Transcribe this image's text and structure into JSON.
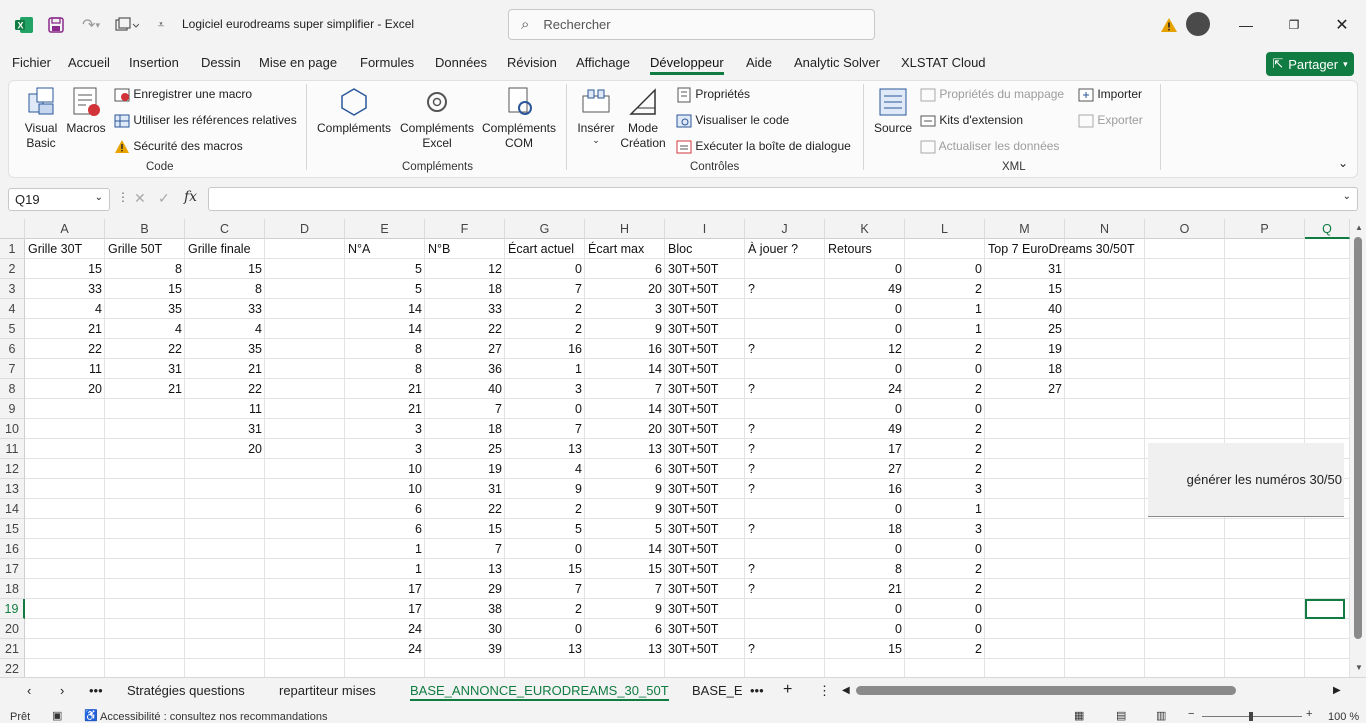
{
  "window": {
    "title": "Logiciel eurodreams super simplifier  -  Excel",
    "search_placeholder": "Rechercher"
  },
  "menu": [
    "Fichier",
    "Accueil",
    "Insertion",
    "Dessin",
    "Mise en page",
    "Formules",
    "Données",
    "Révision",
    "Affichage",
    "Développeur",
    "Aide",
    "Analytic Solver",
    "XLSTAT Cloud"
  ],
  "share_label": "Partager",
  "ribbon": {
    "code": {
      "visual_basic": "Visual\nBasic",
      "macros": "Macros",
      "record_macro": "Enregistrer une macro",
      "relative_refs": "Utiliser les références relatives",
      "macro_security": "Sécurité des macros",
      "group": "Code"
    },
    "addins": {
      "complements": "Compléments",
      "excel_addins": "Compléments\nExcel",
      "com_addins": "Compléments\nCOM",
      "group": "Compléments"
    },
    "controls": {
      "insert": "Insérer",
      "design_mode": "Mode\nCréation",
      "properties": "Propriétés",
      "view_code": "Visualiser le code",
      "run_dialog": "Exécuter la boîte de dialogue",
      "group": "Contrôles"
    },
    "xml": {
      "source": "Source",
      "map_props": "Propriétés du mappage",
      "expansion_packs": "Kits d'extension",
      "refresh_data": "Actualiser les données",
      "import": "Importer",
      "export": "Exporter",
      "group": "XML"
    }
  },
  "namebox": "Q19",
  "fx": "fx",
  "columns": [
    "A",
    "B",
    "C",
    "D",
    "E",
    "F",
    "G",
    "H",
    "I",
    "J",
    "K",
    "L",
    "M",
    "N",
    "O",
    "P",
    "Q"
  ],
  "rows": [
    "1",
    "2",
    "3",
    "4",
    "5",
    "6",
    "7",
    "8",
    "9",
    "10",
    "11",
    "12",
    "13",
    "14",
    "15",
    "16",
    "17",
    "18",
    "19",
    "20",
    "21",
    "22"
  ],
  "headers": {
    "A": "Grille 30T",
    "B": "Grille 50T",
    "C": "Grille finale",
    "E": "N°A",
    "F": "N°B",
    "G": "Écart actuel",
    "H": "Écart max",
    "I": "Bloc",
    "J": "À jouer ?",
    "K": "Retours",
    "M": "Top 7 EuroDreams 30/50T"
  },
  "table": [
    [
      "15",
      "8",
      "15",
      "5",
      "12",
      "0",
      "6",
      "30T+50T",
      "",
      "0",
      "0",
      "31"
    ],
    [
      "33",
      "15",
      "8",
      "5",
      "18",
      "7",
      "20",
      "30T+50T",
      "?",
      "49",
      "2",
      "15"
    ],
    [
      "4",
      "35",
      "33",
      "14",
      "33",
      "2",
      "3",
      "30T+50T",
      "",
      "0",
      "1",
      "40"
    ],
    [
      "21",
      "4",
      "4",
      "14",
      "22",
      "2",
      "9",
      "30T+50T",
      "",
      "0",
      "1",
      "25"
    ],
    [
      "22",
      "22",
      "35",
      "8",
      "27",
      "16",
      "16",
      "30T+50T",
      "?",
      "12",
      "2",
      "19"
    ],
    [
      "11",
      "31",
      "21",
      "8",
      "36",
      "1",
      "14",
      "30T+50T",
      "",
      "0",
      "0",
      "18"
    ],
    [
      "20",
      "21",
      "22",
      "21",
      "40",
      "3",
      "7",
      "30T+50T",
      "?",
      "24",
      "2",
      "27"
    ],
    [
      "",
      "",
      "11",
      "21",
      "7",
      "0",
      "14",
      "30T+50T",
      "",
      "0",
      "0",
      ""
    ],
    [
      "",
      "",
      "31",
      "3",
      "18",
      "7",
      "20",
      "30T+50T",
      "?",
      "49",
      "2",
      ""
    ],
    [
      "",
      "",
      "20",
      "3",
      "25",
      "13",
      "13",
      "30T+50T",
      "?",
      "17",
      "2",
      ""
    ],
    [
      "",
      "",
      "",
      "10",
      "19",
      "4",
      "6",
      "30T+50T",
      "?",
      "27",
      "2",
      ""
    ],
    [
      "",
      "",
      "",
      "10",
      "31",
      "9",
      "9",
      "30T+50T",
      "?",
      "16",
      "3",
      ""
    ],
    [
      "",
      "",
      "",
      "6",
      "22",
      "2",
      "9",
      "30T+50T",
      "",
      "0",
      "1",
      ""
    ],
    [
      "",
      "",
      "",
      "6",
      "15",
      "5",
      "5",
      "30T+50T",
      "?",
      "18",
      "3",
      ""
    ],
    [
      "",
      "",
      "",
      "1",
      "7",
      "0",
      "14",
      "30T+50T",
      "",
      "0",
      "0",
      ""
    ],
    [
      "",
      "",
      "",
      "1",
      "13",
      "15",
      "15",
      "30T+50T",
      "?",
      "8",
      "2",
      ""
    ],
    [
      "",
      "",
      "",
      "17",
      "29",
      "7",
      "7",
      "30T+50T",
      "?",
      "21",
      "2",
      ""
    ],
    [
      "",
      "",
      "",
      "17",
      "38",
      "2",
      "9",
      "30T+50T",
      "",
      "0",
      "0",
      ""
    ],
    [
      "",
      "",
      "",
      "24",
      "30",
      "0",
      "6",
      "30T+50T",
      "",
      "0",
      "0",
      ""
    ],
    [
      "",
      "",
      "",
      "24",
      "39",
      "13",
      "13",
      "30T+50T",
      "?",
      "15",
      "2",
      ""
    ]
  ],
  "generate_button": "générer les numéros 30/50",
  "sheet_tabs": [
    "Stratégies questions",
    "repartiteur mises",
    "BASE_ANNONCE_EURODREAMS_30_50T",
    "BASE_EU"
  ],
  "status": {
    "ready": "Prêt",
    "accessibility": "Accessibilité : consultez nos recommandations",
    "zoom": "100 %"
  },
  "colors": {
    "accent": "#107c41"
  }
}
